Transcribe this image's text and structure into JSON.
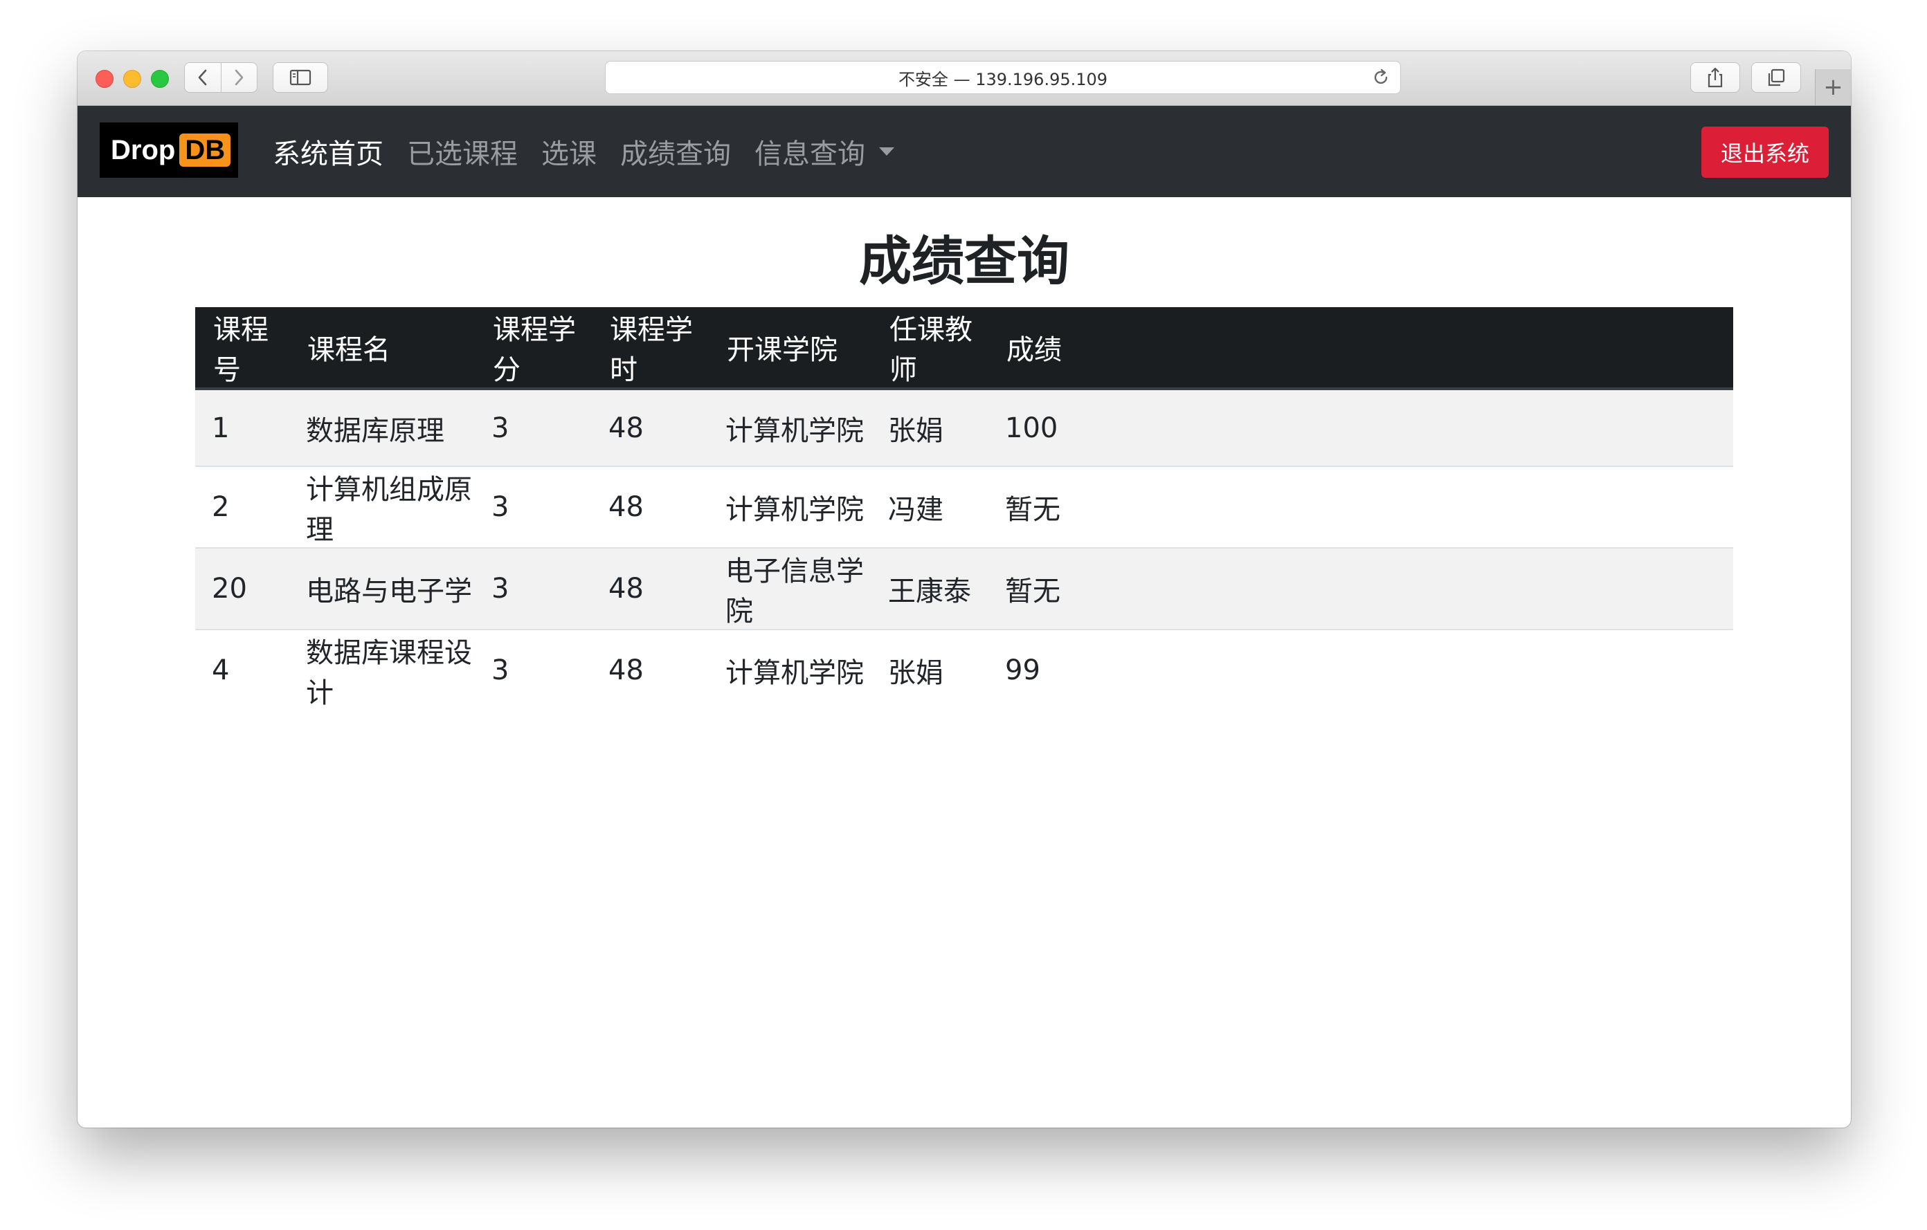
{
  "browser": {
    "url_text": "不安全 — 139.196.95.109",
    "new_tab_symbol": "+"
  },
  "navbar": {
    "logo": {
      "text": "Drop",
      "badge": "DB",
      "badge_color": "#f7931a"
    },
    "links": [
      {
        "label": "系统首页",
        "active": true
      },
      {
        "label": "已选课程",
        "active": false
      },
      {
        "label": "选课",
        "active": false
      },
      {
        "label": "成绩查询",
        "active": false
      },
      {
        "label": "信息查询",
        "active": false,
        "dropdown": true
      }
    ],
    "logout_label": "退出系统",
    "logout_color": "#dc1f36",
    "background": "#2b2f33"
  },
  "main": {
    "title": "成绩查询",
    "table": {
      "headers": [
        "课程号",
        "课程名",
        "课程学分",
        "课程学时",
        "开课学院",
        "任课教师",
        "成绩"
      ],
      "rows": [
        [
          "1",
          "数据库原理",
          "3",
          "48",
          "计算机学院",
          "张娟",
          "100"
        ],
        [
          "2",
          "计算机组成原理",
          "3",
          "48",
          "计算机学院",
          "冯建",
          "暂无"
        ],
        [
          "20",
          "电路与电子学",
          "3",
          "48",
          "电子信息学院",
          "王康泰",
          "暂无"
        ],
        [
          "4",
          "数据库课程设计",
          "3",
          "48",
          "计算机学院",
          "张娟",
          "99"
        ]
      ]
    }
  }
}
